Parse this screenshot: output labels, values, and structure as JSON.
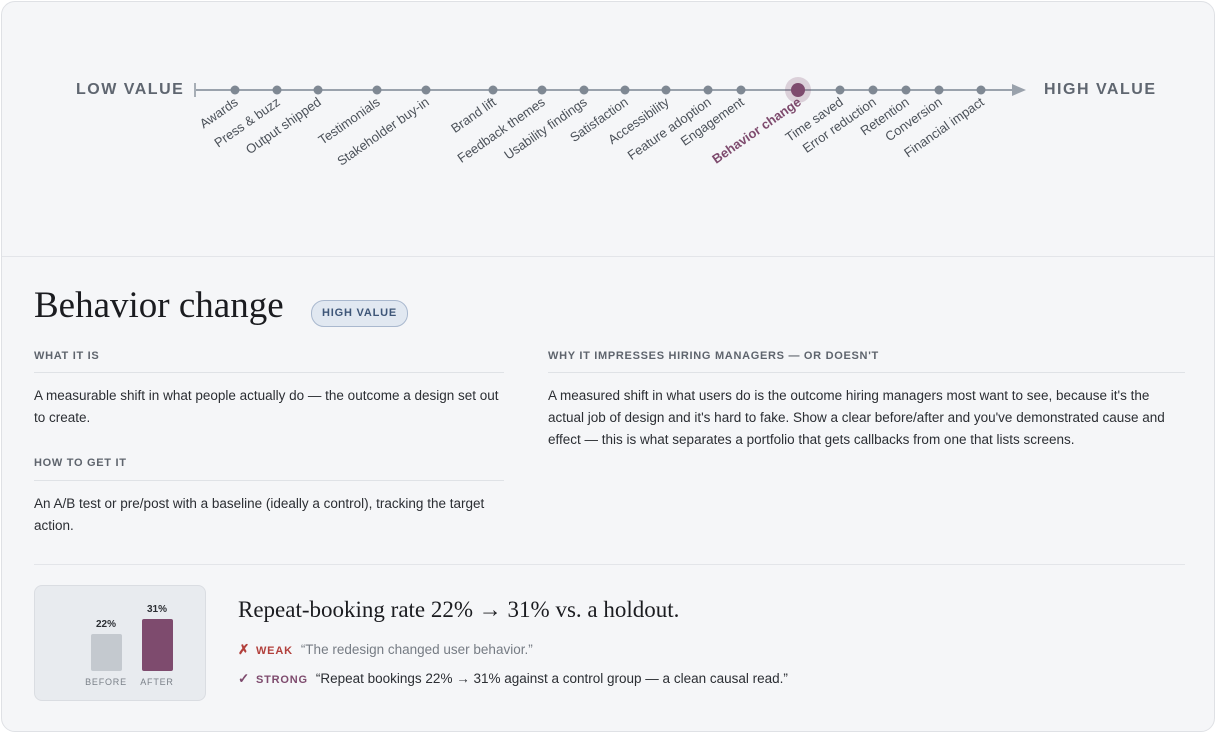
{
  "scale": {
    "low_label": "LOW VALUE",
    "high_label": "HIGH VALUE",
    "items": [
      "Awards",
      "Press & buzz",
      "Output shipped",
      "Testimonials",
      "Stakeholder buy-in",
      "Brand lift",
      "Feedback themes",
      "Usability findings",
      "Satisfaction",
      "Accessibility",
      "Feature adoption",
      "Engagement",
      "Behavior change",
      "Time saved",
      "Error reduction",
      "Retention",
      "Conversion",
      "Financial impact"
    ],
    "selected": "Behavior change",
    "accent_color": "#7e4b6e"
  },
  "detail": {
    "title": "Behavior change",
    "value_badge": "HIGH VALUE",
    "what_heading": "WHAT IT IS",
    "what_text": "A measurable shift in what people actually do — the outcome a design set out to create.",
    "how_heading": "HOW TO GET IT",
    "how_text": "An A/B test or pre/post with a baseline (ideally a control), tracking the target action.",
    "why_heading": "WHY IT IMPRESSES HIRING MANAGERS — OR DOESN'T",
    "why_text": "A measured shift in what users do is the outcome hiring managers most want to see, because it's the actual job of design and it's hard to fake. Show a clear before/after and you've demonstrated cause and effect — this is what separates a portfolio that gets callbacks from one that lists screens."
  },
  "example": {
    "headline": "Repeat-booking rate 22% → 31% vs. a holdout.",
    "weak_mark": "✗",
    "weak_label": "WEAK",
    "weak_quote": "“The redesign changed user behavior.”",
    "strong_mark": "✓",
    "strong_label": "STRONG",
    "strong_quote": "“Repeat bookings 22% → 31% against a control group — a clean causal read.”"
  },
  "chart_data": {
    "type": "bar",
    "categories": [
      "BEFORE",
      "AFTER"
    ],
    "values": [
      22,
      31
    ],
    "value_labels": [
      "22%",
      "31%"
    ],
    "colors": [
      "#c4c9cf",
      "#7e4b6e"
    ]
  }
}
